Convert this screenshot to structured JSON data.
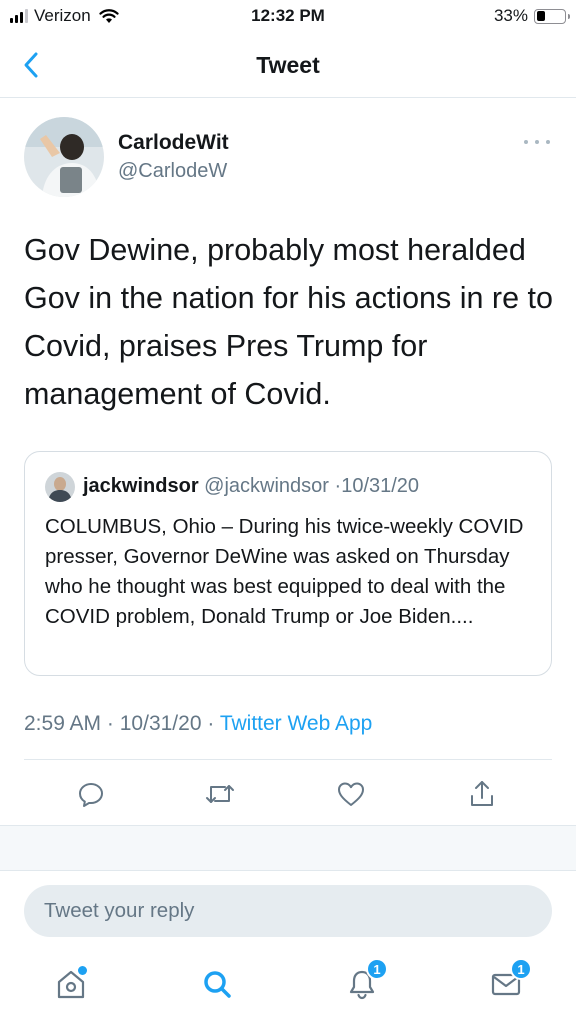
{
  "status_bar": {
    "carrier": "Verizon",
    "time": "12:32 PM",
    "battery_percent": "33%",
    "battery_level": 0.33
  },
  "header": {
    "title": "Tweet",
    "back_icon": "chevron-left-icon"
  },
  "tweet": {
    "author_name": "CarlodeWit",
    "author_handle": "@CarlodeW",
    "text": "Gov Dewine, probably most heralded Gov in the nation for his actions in re to Covid, praises Pres Trump for management of Covid.",
    "time": "2:59 AM",
    "date": "10/31/20",
    "source": "Twitter Web App",
    "separator": "·"
  },
  "quoted_tweet": {
    "author_name": "jackwindsor",
    "author_handle": "@jackwindsor",
    "date": "10/31/20",
    "separator": "·",
    "text": "COLUMBUS, Ohio – During his twice-weekly COVID presser, Governor DeWine was asked on Thursday who he thought was best equipped to deal with the COVID problem, Donald Trump or Joe Biden...."
  },
  "reply": {
    "placeholder": "Tweet your reply"
  },
  "tab_bar": {
    "notifications_badge": "1",
    "messages_badge": "1"
  },
  "colors": {
    "accent": "#1da1f2",
    "text_primary": "#14171a",
    "text_secondary": "#657786",
    "icon_gray": "#657786"
  }
}
